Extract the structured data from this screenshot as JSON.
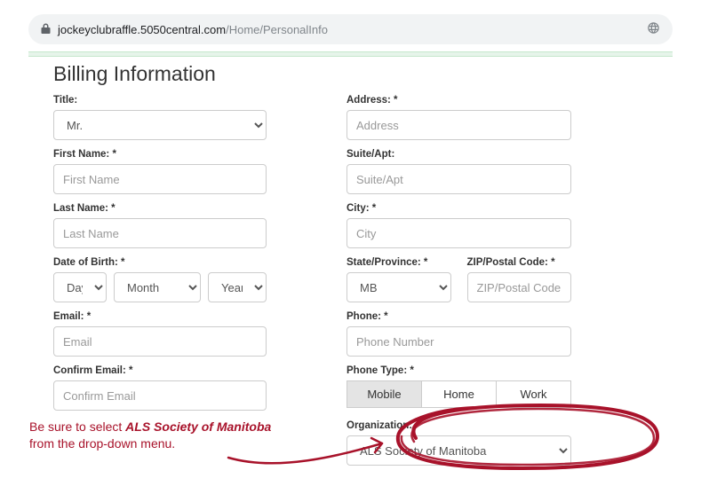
{
  "url": {
    "domain": "jockeyclubraffle.5050central.com",
    "path": "/Home/PersonalInfo"
  },
  "heading": "Billing Information",
  "left": {
    "title_label": "Title:",
    "title_value": "Mr.",
    "first_label": "First Name: *",
    "first_placeholder": "First Name",
    "last_label": "Last Name: *",
    "last_placeholder": "Last Name",
    "dob_label": "Date of Birth: *",
    "dob_day": "Day",
    "dob_month": "Month",
    "dob_year": "Year",
    "email_label": "Email: *",
    "email_placeholder": "Email",
    "confirm_label": "Confirm Email: *",
    "confirm_placeholder": "Confirm Email"
  },
  "right": {
    "address_label": "Address: *",
    "address_placeholder": "Address",
    "suite_label": "Suite/Apt:",
    "suite_placeholder": "Suite/Apt",
    "city_label": "City: *",
    "city_placeholder": "City",
    "state_label": "State/Province: *",
    "state_value": "MB",
    "zip_label": "ZIP/Postal Code: *",
    "zip_placeholder": "ZIP/Postal Code",
    "phone_label": "Phone: *",
    "phone_placeholder": "Phone Number",
    "ptype_label": "Phone Type: *",
    "ptype_mobile": "Mobile",
    "ptype_home": "Home",
    "ptype_work": "Work",
    "org_label": "Organization:",
    "org_value": "ALS Society of Manitoba"
  },
  "annotation": {
    "line_prefix": "Be sure to select ",
    "line_bold": "ALS Society of Manitoba",
    "line2": "from the drop-down menu."
  }
}
